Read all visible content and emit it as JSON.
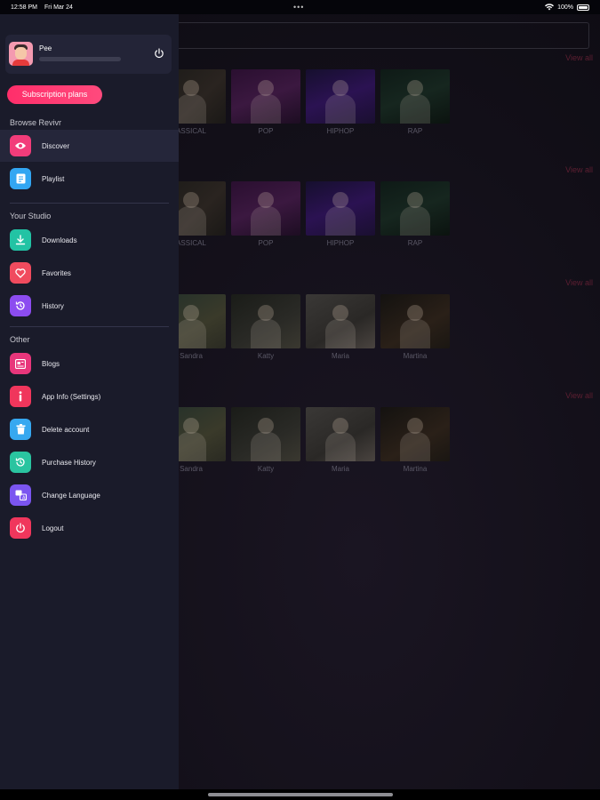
{
  "status_bar": {
    "time": "12:58 PM",
    "date": "Fri Mar 24",
    "dots": "•••",
    "battery": "100%"
  },
  "sections": [
    {
      "view_all": "View all",
      "items": [
        "ASSICAL",
        "POP",
        "HIPHOP",
        "RAP"
      ]
    },
    {
      "view_all": "View all",
      "items": [
        "ASSICAL",
        "POP",
        "HIPHOP",
        "RAP"
      ]
    },
    {
      "view_all": "View all",
      "items": [
        "Sandra",
        "Katty",
        "Maria",
        "Martina"
      ]
    },
    {
      "view_all": "View all",
      "items": [
        "Sandra",
        "Katty",
        "Maria",
        "Martina"
      ]
    }
  ],
  "drawer": {
    "profile": {
      "name": "Pee"
    },
    "subscription_label": "Subscription plans",
    "groups": [
      {
        "title": "Browse Revivr",
        "items": [
          {
            "label": "Discover",
            "icon": "eye-icon"
          },
          {
            "label": "Playlist",
            "icon": "playlist-icon"
          }
        ]
      },
      {
        "title": "Your Studio",
        "items": [
          {
            "label": "Downloads",
            "icon": "download-icon"
          },
          {
            "label": "Favorites",
            "icon": "heart-icon"
          },
          {
            "label": "History",
            "icon": "history-icon"
          }
        ]
      },
      {
        "title": "Other",
        "items": [
          {
            "label": "Blogs",
            "icon": "blog-icon"
          },
          {
            "label": "App Info (Settings)",
            "icon": "info-icon"
          },
          {
            "label": "Delete account",
            "icon": "trash-icon"
          },
          {
            "label": "Purchase History",
            "icon": "purchase-history-icon"
          },
          {
            "label": "Change Language",
            "icon": "language-icon"
          },
          {
            "label": "Logout",
            "icon": "logout-icon"
          }
        ]
      }
    ]
  },
  "colors": {
    "accent": "#ff2e6a",
    "drawer_bg": "#1a1b2a",
    "view_all": "#5e1f32"
  }
}
